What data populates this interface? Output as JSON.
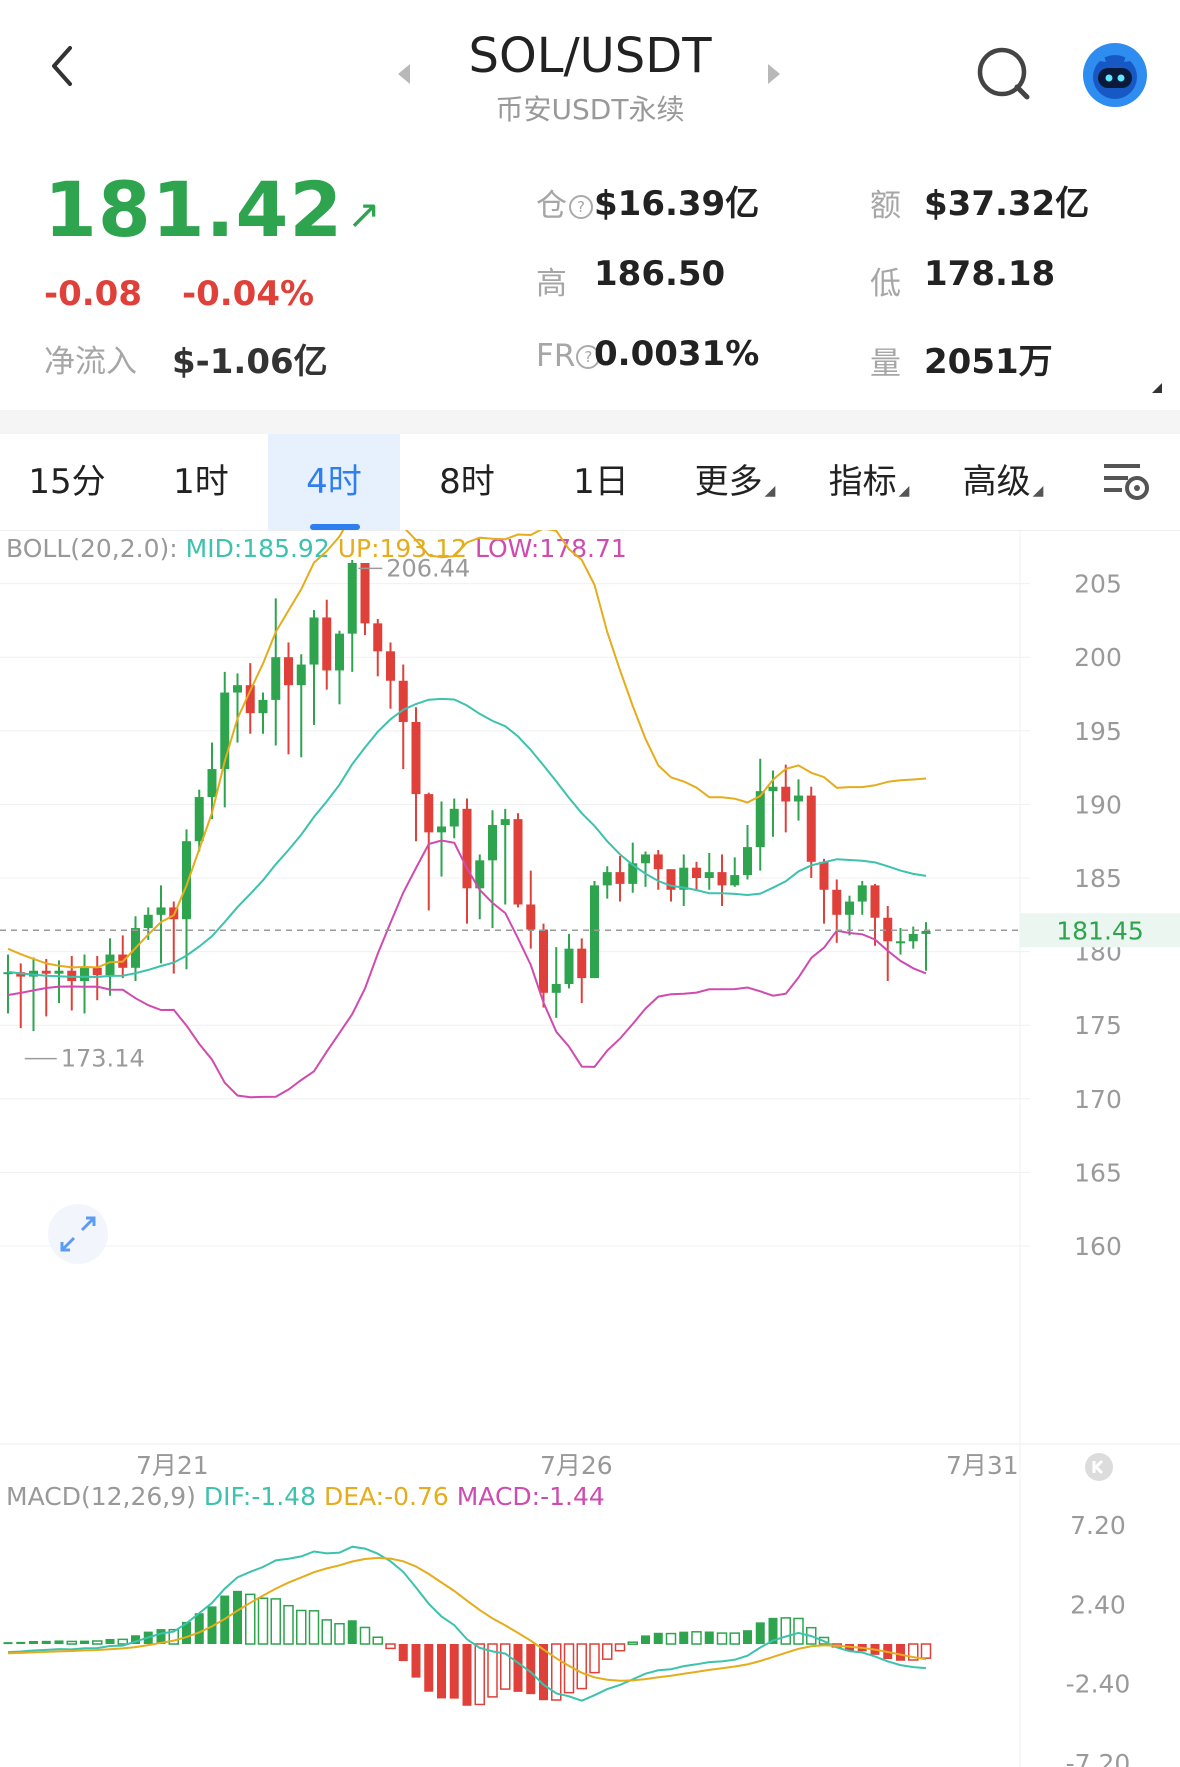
{
  "header": {
    "back": "back",
    "pair": "SOL/USDT",
    "sub": "币安USDT永续",
    "prev": "◀",
    "next": "▶"
  },
  "ticker": {
    "price": "181.42",
    "arrow": "↗",
    "change": "-0.08",
    "change_pct": "-0.04%",
    "netflow_label": "净流入",
    "netflow_value": "$-1.06亿",
    "open_interest_label": "仓",
    "open_interest_value": "$16.39亿",
    "turnover_label": "额",
    "turnover_value": "$37.32亿",
    "high_label": "高",
    "high_value": "186.50",
    "low_label": "低",
    "low_value": "178.18",
    "fr_label": "FR",
    "fr_value": "0.0031%",
    "volume_label": "量",
    "volume_value": "2051万"
  },
  "tabs": {
    "items": [
      "15分",
      "1时",
      "4时",
      "8时",
      "1日"
    ],
    "active": "4时",
    "more": "更多",
    "indicators": "指标",
    "advanced": "高级"
  },
  "boll": {
    "name": "BOLL(20,2.0):",
    "mid": "MID:185.92",
    "up": "UP:193.12",
    "low": "LOW:178.71",
    "colors": {
      "mid": "#3cc2ad",
      "up": "#e5ac1c",
      "low": "#cf4bb0"
    }
  },
  "macd": {
    "name": "MACD(12,26,9)",
    "dif": "DIF:-1.48",
    "dea": "DEA:-0.76",
    "macd": "MACD:-1.44",
    "colors": {
      "dif": "#3cc2ad",
      "dea": "#e5ac1c",
      "macd": "#cf4bb0"
    },
    "y_ticks": [
      "7.20",
      "2.40",
      "-2.40",
      "-7.20"
    ]
  },
  "chart_data": {
    "type": "candlestick",
    "y_ticks": [
      205,
      200,
      195,
      190,
      185,
      180,
      175,
      170,
      165,
      160
    ],
    "x_labels": [
      "7月21",
      "7月26",
      "7月31"
    ],
    "current_price": "181.45",
    "max_label": "206.44",
    "min_label": "173.14",
    "candles": [
      {
        "o": 178.5,
        "c": 178.6,
        "h": 179.8,
        "l": 175.8
      },
      {
        "o": 178.6,
        "c": 178.3,
        "h": 179.2,
        "l": 174.8
      },
      {
        "o": 178.3,
        "c": 178.7,
        "h": 179.6,
        "l": 174.6
      },
      {
        "o": 178.7,
        "c": 178.5,
        "h": 179.5,
        "l": 175.6
      },
      {
        "o": 178.5,
        "c": 178.7,
        "h": 179.4,
        "l": 176.5
      },
      {
        "o": 178.7,
        "c": 178.0,
        "h": 179.7,
        "l": 176.0
      },
      {
        "o": 178.0,
        "c": 178.9,
        "h": 179.8,
        "l": 175.8
      },
      {
        "o": 178.9,
        "c": 178.4,
        "h": 179.7,
        "l": 176.7
      },
      {
        "o": 178.4,
        "c": 179.8,
        "h": 180.9,
        "l": 177.0
      },
      {
        "o": 179.8,
        "c": 178.9,
        "h": 181.1,
        "l": 178.2
      },
      {
        "o": 178.9,
        "c": 181.6,
        "h": 182.4,
        "l": 178.0
      },
      {
        "o": 181.6,
        "c": 182.5,
        "h": 183.0,
        "l": 180.8
      },
      {
        "o": 182.5,
        "c": 183.0,
        "h": 184.5,
        "l": 179.2
      },
      {
        "o": 183.0,
        "c": 182.2,
        "h": 183.4,
        "l": 178.5
      },
      {
        "o": 182.2,
        "c": 187.5,
        "h": 188.3,
        "l": 178.8
      },
      {
        "o": 187.5,
        "c": 190.5,
        "h": 191.0,
        "l": 186.8
      },
      {
        "o": 190.5,
        "c": 192.4,
        "h": 194.2,
        "l": 189.0
      },
      {
        "o": 192.4,
        "c": 197.6,
        "h": 199.0,
        "l": 189.8
      },
      {
        "o": 197.6,
        "c": 198.1,
        "h": 198.9,
        "l": 194.2
      },
      {
        "o": 198.1,
        "c": 196.2,
        "h": 199.6,
        "l": 194.8
      },
      {
        "o": 196.2,
        "c": 197.1,
        "h": 197.6,
        "l": 194.8
      },
      {
        "o": 197.1,
        "c": 200.0,
        "h": 204.0,
        "l": 194.0
      },
      {
        "o": 200.0,
        "c": 198.1,
        "h": 201.0,
        "l": 193.4
      },
      {
        "o": 198.1,
        "c": 199.5,
        "h": 200.2,
        "l": 193.2
      },
      {
        "o": 199.5,
        "c": 202.7,
        "h": 203.2,
        "l": 195.4
      },
      {
        "o": 202.7,
        "c": 199.1,
        "h": 203.9,
        "l": 197.8
      },
      {
        "o": 199.1,
        "c": 201.6,
        "h": 201.8,
        "l": 196.8
      },
      {
        "o": 201.6,
        "c": 206.4,
        "h": 206.6,
        "l": 199.0
      },
      {
        "o": 206.4,
        "c": 202.3,
        "h": 206.0,
        "l": 201.5
      },
      {
        "o": 202.3,
        "c": 200.4,
        "h": 202.6,
        "l": 198.7
      },
      {
        "o": 200.4,
        "c": 198.4,
        "h": 201.0,
        "l": 196.5
      },
      {
        "o": 198.4,
        "c": 195.6,
        "h": 199.5,
        "l": 192.4
      },
      {
        "o": 195.6,
        "c": 190.7,
        "h": 196.6,
        "l": 187.5
      },
      {
        "o": 190.7,
        "c": 188.1,
        "h": 190.8,
        "l": 182.8
      },
      {
        "o": 188.1,
        "c": 188.5,
        "h": 190.2,
        "l": 185.1
      },
      {
        "o": 188.5,
        "c": 189.7,
        "h": 190.4,
        "l": 187.7
      },
      {
        "o": 189.7,
        "c": 184.3,
        "h": 190.4,
        "l": 181.9
      },
      {
        "o": 184.3,
        "c": 186.2,
        "h": 186.6,
        "l": 182.2
      },
      {
        "o": 186.2,
        "c": 188.6,
        "h": 189.6,
        "l": 181.6
      },
      {
        "o": 188.6,
        "c": 189.0,
        "h": 189.7,
        "l": 183.2
      },
      {
        "o": 189.0,
        "c": 183.2,
        "h": 189.4,
        "l": 183.0
      },
      {
        "o": 183.2,
        "c": 181.5,
        "h": 185.5,
        "l": 180.2
      },
      {
        "o": 181.5,
        "c": 177.2,
        "h": 181.9,
        "l": 176.2
      },
      {
        "o": 177.2,
        "c": 177.8,
        "h": 180.3,
        "l": 175.5
      },
      {
        "o": 177.8,
        "c": 180.2,
        "h": 181.2,
        "l": 177.5
      },
      {
        "o": 180.2,
        "c": 178.2,
        "h": 180.9,
        "l": 176.5
      },
      {
        "o": 178.2,
        "c": 184.5,
        "h": 184.8,
        "l": 178.2
      },
      {
        "o": 184.5,
        "c": 185.4,
        "h": 185.8,
        "l": 183.6
      },
      {
        "o": 185.4,
        "c": 184.6,
        "h": 186.5,
        "l": 183.4
      },
      {
        "o": 184.6,
        "c": 186.0,
        "h": 187.4,
        "l": 184.0
      },
      {
        "o": 186.0,
        "c": 186.6,
        "h": 186.8,
        "l": 184.4
      },
      {
        "o": 186.6,
        "c": 185.6,
        "h": 186.9,
        "l": 184.2
      },
      {
        "o": 185.6,
        "c": 184.2,
        "h": 185.5,
        "l": 183.4
      },
      {
        "o": 184.2,
        "c": 185.7,
        "h": 186.6,
        "l": 183.1
      },
      {
        "o": 185.7,
        "c": 185.0,
        "h": 186.1,
        "l": 184.2
      },
      {
        "o": 185.0,
        "c": 185.4,
        "h": 186.7,
        "l": 184.2
      },
      {
        "o": 185.4,
        "c": 184.5,
        "h": 186.6,
        "l": 183.1
      },
      {
        "o": 184.5,
        "c": 185.2,
        "h": 186.4,
        "l": 184.4
      },
      {
        "o": 185.2,
        "c": 187.1,
        "h": 188.6,
        "l": 184.9
      },
      {
        "o": 187.1,
        "c": 190.9,
        "h": 193.1,
        "l": 185.5
      },
      {
        "o": 190.9,
        "c": 191.2,
        "h": 192.3,
        "l": 187.8
      },
      {
        "o": 191.2,
        "c": 190.2,
        "h": 192.7,
        "l": 188.1
      },
      {
        "o": 190.2,
        "c": 190.6,
        "h": 191.7,
        "l": 188.9
      },
      {
        "o": 190.6,
        "c": 186.1,
        "h": 191.2,
        "l": 185.0
      },
      {
        "o": 186.1,
        "c": 184.2,
        "h": 186.3,
        "l": 181.9
      },
      {
        "o": 184.2,
        "c": 182.5,
        "h": 184.9,
        "l": 180.6
      },
      {
        "o": 182.5,
        "c": 183.4,
        "h": 183.8,
        "l": 181.1
      },
      {
        "o": 183.4,
        "c": 184.5,
        "h": 184.8,
        "l": 182.5
      },
      {
        "o": 184.5,
        "c": 182.3,
        "h": 184.6,
        "l": 180.4
      },
      {
        "o": 182.3,
        "c": 180.7,
        "h": 183.1,
        "l": 178.0
      },
      {
        "o": 180.7,
        "c": 180.7,
        "h": 181.6,
        "l": 179.8
      },
      {
        "o": 180.7,
        "c": 181.2,
        "h": 181.7,
        "l": 180.2
      },
      {
        "o": 181.2,
        "c": 181.4,
        "h": 182.0,
        "l": 178.7
      }
    ]
  }
}
